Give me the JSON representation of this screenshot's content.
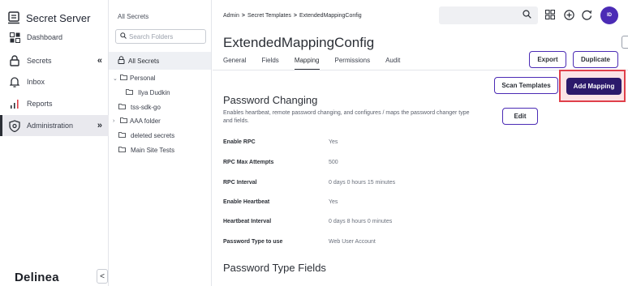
{
  "nav": {
    "brand": "Secret Server",
    "items": [
      {
        "label": "Dashboard",
        "icon": "dashboard-icon"
      },
      {
        "label": "Secrets",
        "icon": "lock-icon",
        "chevron": "«"
      },
      {
        "label": "Inbox",
        "icon": "bell-icon"
      },
      {
        "label": "Reports",
        "icon": "bar-chart-icon"
      },
      {
        "label": "Administration",
        "icon": "shield-gear-icon",
        "chevron": "»"
      }
    ],
    "logo": "Delinea",
    "collapse_glyph": "<"
  },
  "folders": {
    "title": "All Secrets",
    "search_placeholder": "Search Folders",
    "all_secrets": "All Secrets",
    "tree": [
      {
        "label": "Personal",
        "caret": "⌄"
      },
      {
        "label": "Ilya Dudkin",
        "caret": ""
      },
      {
        "label": "tss-sdk-go",
        "caret": ""
      },
      {
        "label": "AAA folder",
        "caret": "›"
      },
      {
        "label": "deleted secrets",
        "caret": ""
      },
      {
        "label": "Main Site Tests",
        "caret": ""
      }
    ]
  },
  "header": {
    "breadcrumb": [
      "Admin",
      "Secret Templates",
      "ExtendedMappingConfig"
    ],
    "breadcrumb_sep": ">",
    "avatar": "ID"
  },
  "page": {
    "title": "ExtendedMappingConfig",
    "tabs": [
      "General",
      "Fields",
      "Mapping",
      "Permissions",
      "Audit"
    ],
    "active_tab": "Mapping",
    "export_label": "Export",
    "duplicate_label": "Duplicate",
    "scan_templates_label": "Scan Templates",
    "add_mapping_label": "Add Mapping",
    "edit_label": "Edit",
    "highlight_color": "#e0404a"
  },
  "password_changing": {
    "title": "Password Changing",
    "description": "Enables heartbeat, remote password changing, and configures / maps the password changer type and fields.",
    "rows": [
      {
        "label": "Enable RPC",
        "value": "Yes"
      },
      {
        "label": "RPC Max Attempts",
        "value": "500"
      },
      {
        "label": "RPC Interval",
        "value": "0 days 0 hours 15 minutes"
      },
      {
        "label": "Enable Heartbeat",
        "value": "Yes"
      },
      {
        "label": "Heartbeat Interval",
        "value": "0 days 8 hours 0 minutes"
      },
      {
        "label": "Password Type to use",
        "value": "Web User Account"
      }
    ]
  },
  "password_type_fields": {
    "title": "Password Type Fields"
  }
}
